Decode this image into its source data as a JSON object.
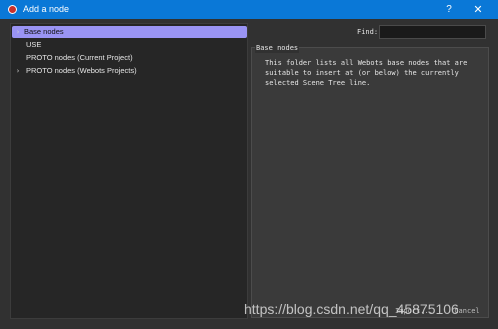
{
  "window": {
    "title": "Add a node",
    "help_label": "?",
    "close_label": "✕",
    "icon": "webots-app-icon"
  },
  "tree": {
    "items": [
      {
        "label": "Base nodes",
        "expandable": true,
        "selected": true
      },
      {
        "label": "USE",
        "expandable": false,
        "selected": false
      },
      {
        "label": "PROTO nodes (Current Project)",
        "expandable": false,
        "selected": false
      },
      {
        "label": "PROTO nodes (Webots Projects)",
        "expandable": true,
        "selected": false
      }
    ],
    "expand_glyph": "›"
  },
  "find": {
    "label": "Find:",
    "value": "",
    "placeholder": ""
  },
  "info": {
    "title": "Base nodes",
    "text": "This folder lists all Webots base nodes that are suitable to insert at (or below) the currently selected Scene Tree line."
  },
  "footer": {
    "import_label": "Import...",
    "cancel_label": "Cancel"
  },
  "watermark": "https://blog.csdn.net/qq_45875106",
  "colors": {
    "titlebar": "#0a78d7",
    "selection": "#9a94f4",
    "background": "#313131"
  }
}
